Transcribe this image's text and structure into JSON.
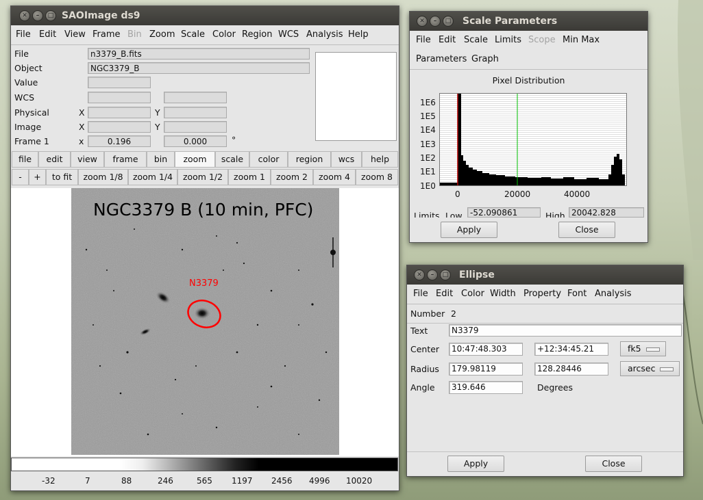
{
  "ds9": {
    "title": "SAOImage ds9",
    "menu": [
      "File",
      "Edit",
      "View",
      "Frame",
      "Bin",
      "Zoom",
      "Scale",
      "Color",
      "Region",
      "WCS",
      "Analysis",
      "Help"
    ],
    "info": {
      "file_label": "File",
      "file_value": "n3379_B.fits",
      "object_label": "Object",
      "object_value": "NGC3379_B",
      "value_label": "Value",
      "wcs_label": "WCS",
      "physical_label": "Physical",
      "image_label": "Image",
      "frame_label": "Frame 1",
      "x_label": "X",
      "y_label": "Y",
      "x_lower": "x",
      "frame_x": "0.196",
      "frame_angle": "0.000",
      "degree_symbol": "°"
    },
    "buttons_row1": [
      "file",
      "edit",
      "view",
      "frame",
      "bin",
      "zoom",
      "scale",
      "color",
      "region",
      "wcs",
      "help"
    ],
    "buttons_row2": [
      "-",
      "+",
      "to fit",
      "zoom 1/8",
      "zoom 1/4",
      "zoom 1/2",
      "zoom 1",
      "zoom 2",
      "zoom 4",
      "zoom 8"
    ],
    "image_title": "NGC3379 B (10 min, PFC)",
    "region_label": "N3379",
    "colorbar_ticks": [
      "-32",
      "7",
      "88",
      "246",
      "565",
      "1197",
      "2456",
      "4996",
      "10020"
    ]
  },
  "scale": {
    "title": "Scale Parameters",
    "menu": [
      "File",
      "Edit",
      "Scale",
      "Limits",
      "Scope",
      "Min Max"
    ],
    "menu2": [
      "Parameters",
      "Graph"
    ],
    "graph_title": "Pixel Distribution",
    "y_ticks": [
      "1E6",
      "1E5",
      "1E4",
      "1E3",
      "1E2",
      "1E1",
      "1E0"
    ],
    "x_ticks": [
      "0",
      "20000",
      "40000"
    ],
    "limits_label": "Limits",
    "low_label": "Low",
    "low_value": "-52.090861",
    "high_label": "High",
    "high_value": "20042.828",
    "apply": "Apply",
    "close": "Close"
  },
  "ellipse": {
    "title": "Ellipse",
    "menu": [
      "File",
      "Edit",
      "Color",
      "Width",
      "Property",
      "Font",
      "Analysis"
    ],
    "number_label": "Number",
    "number_value": "2",
    "text_label": "Text",
    "text_value": "N3379",
    "center_label": "Center",
    "center_ra": "10:47:48.303",
    "center_dec": "+12:34:45.21",
    "center_system": "fk5",
    "radius_label": "Radius",
    "radius_a": "179.98119",
    "radius_b": "128.28446",
    "radius_unit": "arcsec",
    "angle_label": "Angle",
    "angle_value": "319.646",
    "angle_unit": "Degrees",
    "apply": "Apply",
    "close": "Close"
  },
  "colors": {
    "region": "#ff0000",
    "titlebar": "#45443f",
    "histogram_low_line": "#b40000",
    "histogram_high_line": "#00c000"
  }
}
